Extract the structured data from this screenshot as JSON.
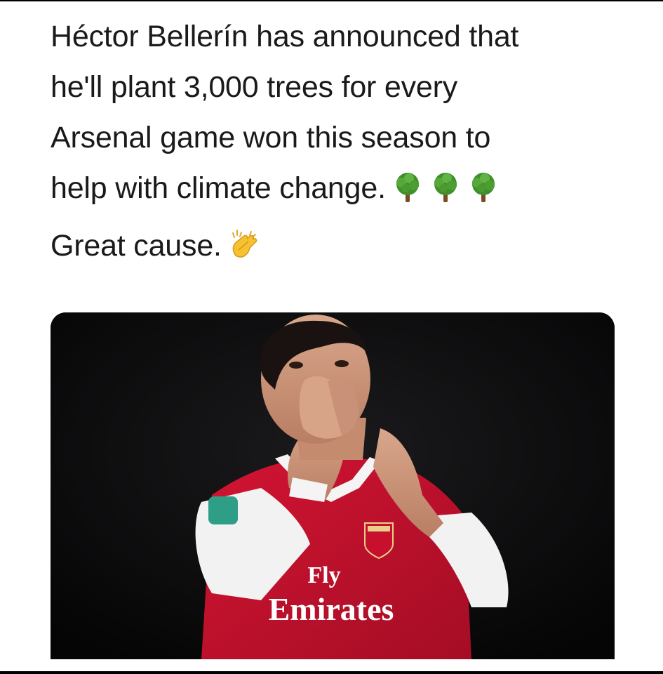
{
  "post": {
    "lines": [
      "Héctor Bellerín has announced that",
      "he'll plant 3,000 trees for every",
      "Arsenal game won this season to",
      "help with climate change."
    ],
    "second_paragraph": "Great cause.",
    "emojis": {
      "tree": "deciduous-tree-emoji",
      "tree_count": 3,
      "clap": "clapping-hands-emoji"
    }
  },
  "photo": {
    "shirt_sponsor_line1": "Fly",
    "shirt_sponsor_line2": "Emirates",
    "colors": {
      "shirt_red": "#c8102e",
      "sleeve_white": "#f2f2f2",
      "background": "#0c0b0c"
    }
  }
}
